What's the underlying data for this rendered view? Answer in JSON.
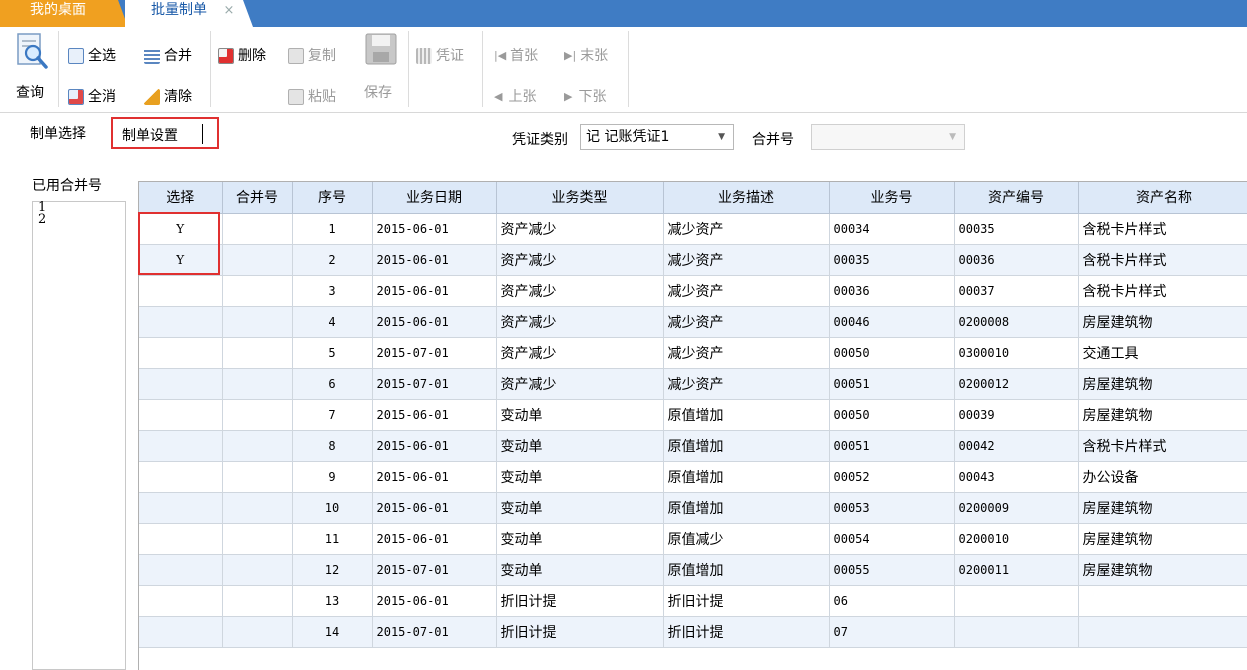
{
  "tabs": {
    "home": "我的桌面",
    "active": "批量制单",
    "close": "×"
  },
  "toolbar": {
    "query": "查询",
    "select_all": "全选",
    "deselect_all": "全消",
    "merge": "合并",
    "clear": "清除",
    "delete": "删除",
    "copy": "复制",
    "paste": "粘贴",
    "save": "保存",
    "voucher": "凭证",
    "first": "首张",
    "last": "末张",
    "prev": "上张",
    "next": "下张"
  },
  "options": {
    "tab_select": "制单选择",
    "tab_settings": "制单设置",
    "voucher_type_label": "凭证类别",
    "voucher_type_value": "记 记账凭证1",
    "merge_no_label": "合并号",
    "merge_no_value": ""
  },
  "used_merge": {
    "label": "已用合并号",
    "items": [
      "1",
      "2"
    ]
  },
  "grid": {
    "headers": [
      "选择",
      "合并号",
      "序号",
      "业务日期",
      "业务类型",
      "业务描述",
      "业务号",
      "资产编号",
      "资产名称"
    ],
    "rows": [
      [
        "Y",
        "",
        "1",
        "2015-06-01",
        "资产减少",
        "减少资产",
        "00034",
        "00035",
        "含税卡片样式"
      ],
      [
        "Y",
        "",
        "2",
        "2015-06-01",
        "资产减少",
        "减少资产",
        "00035",
        "00036",
        "含税卡片样式"
      ],
      [
        "",
        "",
        "3",
        "2015-06-01",
        "资产减少",
        "减少资产",
        "00036",
        "00037",
        "含税卡片样式"
      ],
      [
        "",
        "",
        "4",
        "2015-06-01",
        "资产减少",
        "减少资产",
        "00046",
        "0200008",
        "房屋建筑物"
      ],
      [
        "",
        "",
        "5",
        "2015-07-01",
        "资产减少",
        "减少资产",
        "00050",
        "0300010",
        "交通工具"
      ],
      [
        "",
        "",
        "6",
        "2015-07-01",
        "资产减少",
        "减少资产",
        "00051",
        "0200012",
        "房屋建筑物"
      ],
      [
        "",
        "",
        "7",
        "2015-06-01",
        "变动单",
        "原值增加",
        "00050",
        "00039",
        "房屋建筑物"
      ],
      [
        "",
        "",
        "8",
        "2015-06-01",
        "变动单",
        "原值增加",
        "00051",
        "00042",
        "含税卡片样式"
      ],
      [
        "",
        "",
        "9",
        "2015-06-01",
        "变动单",
        "原值增加",
        "00052",
        "00043",
        "办公设备"
      ],
      [
        "",
        "",
        "10",
        "2015-06-01",
        "变动单",
        "原值增加",
        "00053",
        "0200009",
        "房屋建筑物"
      ],
      [
        "",
        "",
        "11",
        "2015-06-01",
        "变动单",
        "原值减少",
        "00054",
        "0200010",
        "房屋建筑物"
      ],
      [
        "",
        "",
        "12",
        "2015-07-01",
        "变动单",
        "原值增加",
        "00055",
        "0200011",
        "房屋建筑物"
      ],
      [
        "",
        "",
        "13",
        "2015-06-01",
        "折旧计提",
        "折旧计提",
        "06",
        "",
        ""
      ],
      [
        "",
        "",
        "14",
        "2015-07-01",
        "折旧计提",
        "折旧计提",
        "07",
        "",
        ""
      ]
    ]
  }
}
